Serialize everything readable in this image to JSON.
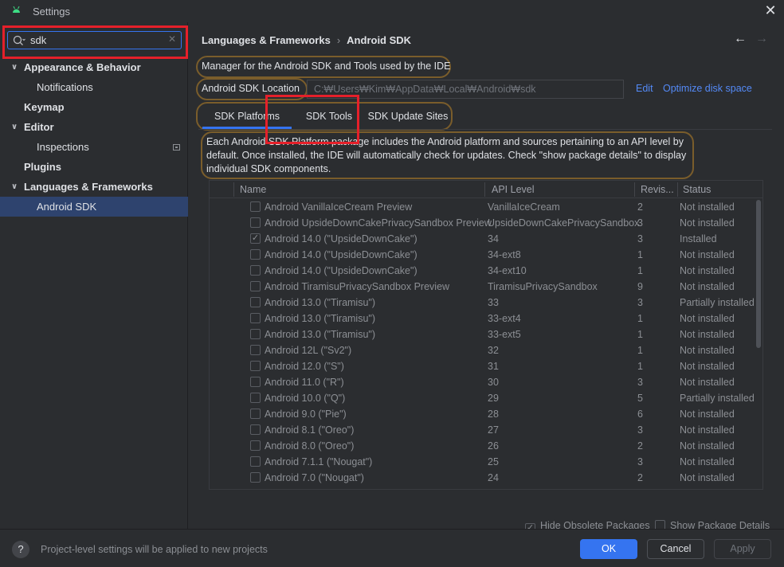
{
  "window": {
    "title": "Settings",
    "close_glyph": "✕"
  },
  "search": {
    "value": "sdk",
    "clear_glyph": "✕"
  },
  "sidebar": {
    "items": [
      {
        "label": "Appearance & Behavior",
        "chevron": "∨"
      },
      {
        "label": "Notifications"
      },
      {
        "label": "Keymap"
      },
      {
        "label": "Editor",
        "chevron": "∨"
      },
      {
        "label": "Inspections"
      },
      {
        "label": "Plugins"
      },
      {
        "label": "Languages & Frameworks",
        "chevron": "∨"
      },
      {
        "label": "Android SDK"
      }
    ]
  },
  "breadcrumb": {
    "parent": "Languages & Frameworks",
    "separator": "›",
    "current": "Android SDK",
    "back_glyph": "←",
    "forward_glyph": "→"
  },
  "manager_description": "Manager for the Android SDK and Tools used by the IDE",
  "sdk_location": {
    "label": "Android SDK Location",
    "value": "C:₩Users₩Kim₩AppData₩Local₩Android₩sdk",
    "edit_link": "Edit",
    "optimize_link": "Optimize disk space"
  },
  "tabs": [
    {
      "label": "SDK Platforms",
      "selected": true
    },
    {
      "label": "SDK Tools",
      "selected": false
    },
    {
      "label": "SDK Update Sites",
      "selected": false
    }
  ],
  "info_text": "Each Android SDK Platform package includes the Android platform and sources pertaining to an API level by default. Once installed, the IDE will automatically check for updates. Check \"show package details\" to display individual SDK components.",
  "table": {
    "columns": {
      "name": "Name",
      "api": "API Level",
      "revision": "Revis...",
      "status": "Status"
    },
    "rows": [
      {
        "checked": false,
        "name": "Android VanillaIceCream Preview",
        "api": "VanillaIceCream",
        "revision": "2",
        "status": "Not installed"
      },
      {
        "checked": false,
        "name": "Android UpsideDownCakePrivacySandbox Preview",
        "api": "UpsideDownCakePrivacySandbox",
        "revision": "3",
        "status": "Not installed"
      },
      {
        "checked": true,
        "name": "Android 14.0 (\"UpsideDownCake\")",
        "api": "34",
        "revision": "3",
        "status": "Installed"
      },
      {
        "checked": false,
        "name": "Android 14.0 (\"UpsideDownCake\")",
        "api": "34-ext8",
        "revision": "1",
        "status": "Not installed"
      },
      {
        "checked": false,
        "name": "Android 14.0 (\"UpsideDownCake\")",
        "api": "34-ext10",
        "revision": "1",
        "status": "Not installed"
      },
      {
        "checked": false,
        "name": "Android TiramisuPrivacySandbox Preview",
        "api": "TiramisuPrivacySandbox",
        "revision": "9",
        "status": "Not installed"
      },
      {
        "checked": false,
        "name": "Android 13.0 (\"Tiramisu\")",
        "api": "33",
        "revision": "3",
        "status": "Partially installed"
      },
      {
        "checked": false,
        "name": "Android 13.0 (\"Tiramisu\")",
        "api": "33-ext4",
        "revision": "1",
        "status": "Not installed"
      },
      {
        "checked": false,
        "name": "Android 13.0 (\"Tiramisu\")",
        "api": "33-ext5",
        "revision": "1",
        "status": "Not installed"
      },
      {
        "checked": false,
        "name": "Android 12L (\"Sv2\")",
        "api": "32",
        "revision": "1",
        "status": "Not installed"
      },
      {
        "checked": false,
        "name": "Android 12.0 (\"S\")",
        "api": "31",
        "revision": "1",
        "status": "Not installed"
      },
      {
        "checked": false,
        "name": "Android 11.0 (\"R\")",
        "api": "30",
        "revision": "3",
        "status": "Not installed"
      },
      {
        "checked": false,
        "name": "Android 10.0 (\"Q\")",
        "api": "29",
        "revision": "5",
        "status": "Partially installed"
      },
      {
        "checked": false,
        "name": "Android 9.0 (\"Pie\")",
        "api": "28",
        "revision": "6",
        "status": "Not installed"
      },
      {
        "checked": false,
        "name": "Android 8.1 (\"Oreo\")",
        "api": "27",
        "revision": "3",
        "status": "Not installed"
      },
      {
        "checked": false,
        "name": "Android 8.0 (\"Oreo\")",
        "api": "26",
        "revision": "2",
        "status": "Not installed"
      },
      {
        "checked": false,
        "name": "Android 7.1.1 (\"Nougat\")",
        "api": "25",
        "revision": "3",
        "status": "Not installed"
      },
      {
        "checked": false,
        "name": "Android 7.0 (\"Nougat\")",
        "api": "24",
        "revision": "2",
        "status": "Not installed"
      }
    ]
  },
  "options": {
    "hide_obsolete": {
      "label": "Hide Obsolete Packages",
      "checked": true
    },
    "show_details": {
      "label": "Show Package Details",
      "checked": false
    }
  },
  "footer": {
    "help_glyph": "?",
    "message": "Project-level settings will be applied to new projects",
    "ok_label": "OK",
    "cancel_label": "Cancel",
    "apply_label": "Apply"
  },
  "colors": {
    "accent": "#3574f0",
    "highlight_red": "#e5202a",
    "selection": "#2e436e",
    "link": "#548af7"
  }
}
